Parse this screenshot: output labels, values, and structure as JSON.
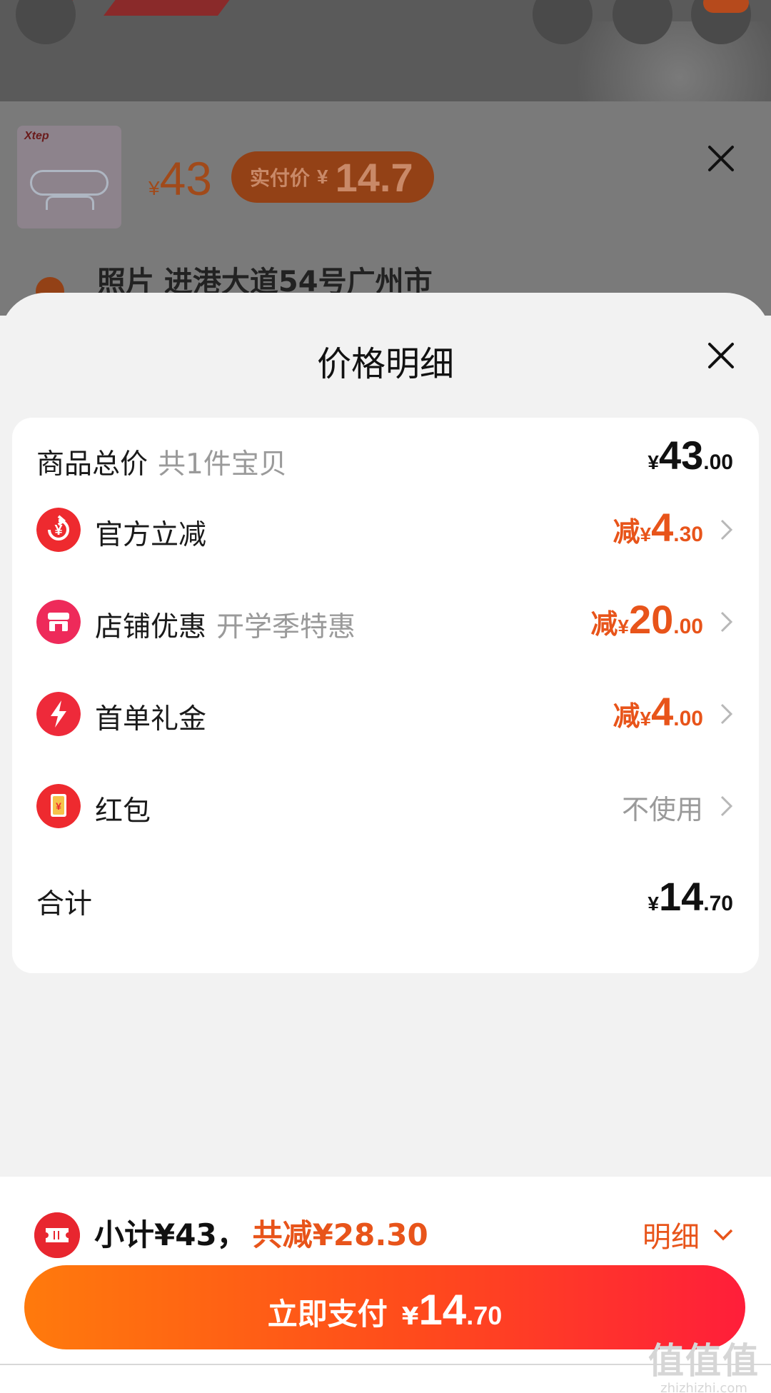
{
  "background": {
    "brand_logo_text": "Xtep",
    "product_thumb_brand": "Xtep",
    "product_price_currency": "¥",
    "product_price": "43",
    "actual_price_label": "实付价",
    "actual_price_currency": "¥",
    "actual_price": "14.7",
    "address": "照片 进港大道54号广州市"
  },
  "sheet": {
    "title": "价格明细",
    "rows": [
      {
        "label": "商品总价",
        "sub": "共1件宝贝",
        "prefix": "",
        "currency": "¥",
        "int": "43",
        "dec": ".00",
        "color": "#111111"
      },
      {
        "label": "官方立减",
        "sub": "",
        "prefix": "减",
        "currency": "¥",
        "int": "4",
        "dec": ".30",
        "color": "#e8541a",
        "icon": "yen-refresh-icon"
      },
      {
        "label": "店铺优惠",
        "sub": "开学季特惠",
        "prefix": "减",
        "currency": "¥",
        "int": "20",
        "dec": ".00",
        "color": "#e8541a",
        "icon": "store-icon"
      },
      {
        "label": "首单礼金",
        "sub": "",
        "prefix": "减",
        "currency": "¥",
        "int": "4",
        "dec": ".00",
        "color": "#e8541a",
        "icon": "lightning-icon"
      },
      {
        "label": "红包",
        "sub": "",
        "value_text": "不使用",
        "icon": "red-envelope-icon"
      },
      {
        "label": "合计",
        "sub": "",
        "prefix": "",
        "currency": "¥",
        "int": "14",
        "dec": ".70",
        "color": "#111111"
      }
    ]
  },
  "bottom": {
    "subtotal": "小计¥43，",
    "discount": "共减¥28.30",
    "detail_label": "明细",
    "pay_label": "立即支付",
    "pay_currency": "¥",
    "pay_int": "14",
    "pay_dec": ".70"
  },
  "watermark": {
    "big": "值值值",
    "small": "zhizhizhi.com"
  },
  "colors": {
    "accent": "#e8541a",
    "red": "#e8262f",
    "pay_gradient_start": "#ff7a0c",
    "pay_gradient_end": "#ff1e3a"
  }
}
